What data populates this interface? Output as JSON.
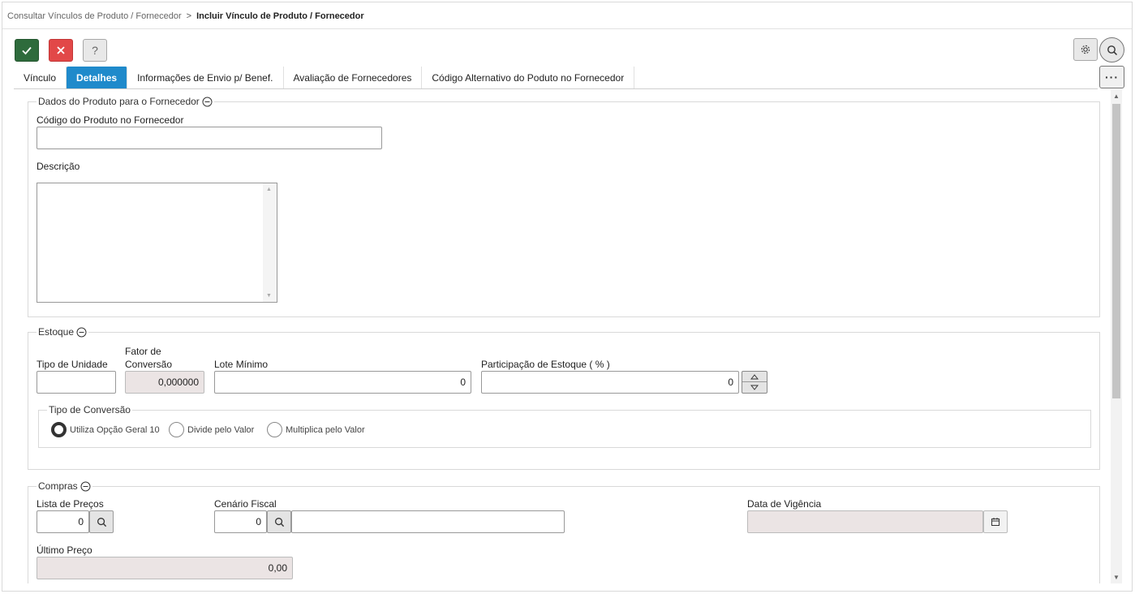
{
  "breadcrumb": {
    "parent": "Consultar Vínculos de Produto / Fornecedor",
    "separator": ">",
    "current": "Incluir Vínculo de Produto / Fornecedor"
  },
  "toolbar": {
    "help_label": "?",
    "more_label": "···"
  },
  "tabs": [
    {
      "label": "Vínculo"
    },
    {
      "label": "Detalhes",
      "active": true
    },
    {
      "label": "Informações de Envio p/ Benef."
    },
    {
      "label": "Avaliação de Fornecedores"
    },
    {
      "label": "Código Alternativo do Poduto no Fornecedor"
    }
  ],
  "dados_produto": {
    "legend": "Dados do Produto para o Fornecedor",
    "codigo_label": "Código do Produto no Fornecedor",
    "codigo_value": "",
    "descricao_label": "Descrição",
    "descricao_value": ""
  },
  "estoque": {
    "legend": "Estoque",
    "tipo_unidade_label": "Tipo de Unidade",
    "tipo_unidade_value": "",
    "fator_label_1": "Fator de",
    "fator_label_2": "Conversão",
    "fator_value": "0,000000",
    "lote_label": "Lote Mínimo",
    "lote_value": "0",
    "participacao_label": "Participação de Estoque ( % )",
    "participacao_value": "0",
    "tipo_conversao": {
      "legend": "Tipo de Conversão",
      "options": [
        {
          "label": "Utiliza Opção Geral 10",
          "checked": true
        },
        {
          "label": "Divide pelo Valor",
          "checked": false
        },
        {
          "label": "Multiplica pelo Valor",
          "checked": false
        }
      ]
    }
  },
  "compras": {
    "legend": "Compras",
    "lista_label": "Lista de Preços",
    "lista_value": "0",
    "cenario_label": "Cenário Fiscal",
    "cenario_value": "0",
    "cenario_desc": "",
    "vigencia_label": "Data de Vigência",
    "vigencia_value": "",
    "ultimo_label": "Último Preço",
    "ultimo_value": "0,00"
  },
  "colors": {
    "ok": "#2e6b3c",
    "cancel": "#e24848",
    "tab_active": "#1f8acb",
    "readonly_bg": "#ebe4e4"
  }
}
